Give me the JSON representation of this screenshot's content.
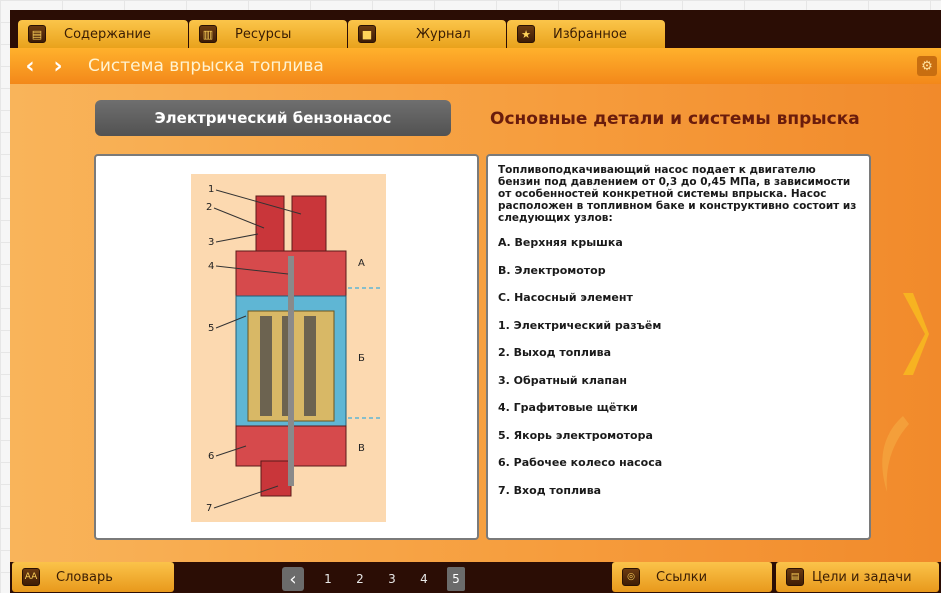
{
  "tabs": [
    {
      "label": "Содержание",
      "icon": "contents-icon"
    },
    {
      "label": "Ресурсы",
      "icon": "resources-icon"
    },
    {
      "label": "Журнал",
      "icon": "journal-icon"
    },
    {
      "label": "Избранное",
      "icon": "favorites-star-icon"
    }
  ],
  "titlebar": {
    "title": "Система впрыска топлива"
  },
  "content": {
    "image_heading": "Электрический бензонасос",
    "panel_heading": "Основные детали и системы впрыска",
    "intro": "Топливоподкачивающий насос подает к двигателю бензин под давлением от 0,3 до 0,45 МПа, в зависимости от особенностей конкретной системы впрыска. Насос расположен в топливном баке и конструктивно состоит из следующих узлов:",
    "parts": [
      "А. Верхняя крышка",
      "B. Электромотор",
      "C. Насосный элемент",
      "1. Электрический разъём",
      "2. Выход топлива",
      "3. Обратный клапан",
      "4. Графитовые щётки",
      "5. Якорь электромотора",
      "6. Рабочее колесо насоса",
      "7. Вход топлива"
    ],
    "diagram": {
      "callouts": [
        "1",
        "2",
        "3",
        "4",
        "5",
        "6",
        "7"
      ],
      "sections": [
        "А",
        "Б",
        "В"
      ]
    }
  },
  "bottom": {
    "dictionary": "Словарь",
    "links": "Ссылки",
    "goals": "Цели и задачи",
    "pages": [
      "1",
      "2",
      "3",
      "4",
      "5"
    ],
    "current_page": "5"
  },
  "colors": {
    "accent": "#f5921f",
    "heading": "#6a1c0c",
    "chrome": "#2b0d05"
  }
}
